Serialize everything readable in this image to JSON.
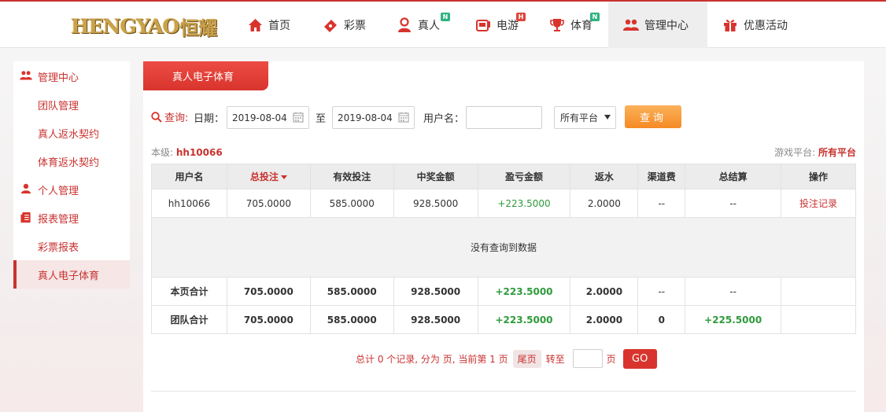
{
  "header": {
    "logo_text": "HENGYAO",
    "logo_cn": "恒耀",
    "nav": [
      {
        "label": "首页",
        "icon": "home-icon",
        "badge": ""
      },
      {
        "label": "彩票",
        "icon": "lottery-ticket-icon",
        "badge": ""
      },
      {
        "label": "真人",
        "icon": "live-dealer-icon",
        "badge": "N"
      },
      {
        "label": "电游",
        "icon": "slot-machine-icon",
        "badge": "H"
      },
      {
        "label": "体育",
        "icon": "trophy-icon",
        "badge": "N"
      },
      {
        "label": "管理中心",
        "icon": "management-users-icon",
        "badge": ""
      },
      {
        "label": "优惠活动",
        "icon": "gift-icon",
        "badge": ""
      }
    ],
    "active_nav": "管理中心"
  },
  "sidebar": {
    "items": [
      {
        "label": "管理中心",
        "type": "head"
      },
      {
        "label": "团队管理",
        "type": "sub"
      },
      {
        "label": "真人返水契约",
        "type": "sub"
      },
      {
        "label": "体育返水契约",
        "type": "sub"
      },
      {
        "label": "个人管理",
        "type": "head"
      },
      {
        "label": "报表管理",
        "type": "head"
      },
      {
        "label": "彩票报表",
        "type": "sub"
      },
      {
        "label": "真人电子体育",
        "type": "sub-active"
      }
    ]
  },
  "main": {
    "tab_title": "真人电子体育",
    "query": {
      "label": "查询:",
      "date_label": "日期：",
      "start_date": "2019-08-04",
      "to_label": "至",
      "end_date": "2019-08-04",
      "username_label": "用户名：",
      "username_value": "",
      "platform_selected": "所有平台",
      "search_button": "查询"
    },
    "level_label": "本级:",
    "level_user": "hh10066",
    "platform_label": "游戏平台:",
    "platform_value": "所有平台",
    "table": {
      "headers": [
        "用户名",
        "总投注",
        "有效投注",
        "中奖金额",
        "盈亏金额",
        "返水",
        "渠道费",
        "总结算",
        "操作"
      ],
      "rows": [
        [
          "hh10066",
          "705.0000",
          "585.0000",
          "928.5000",
          "+223.5000",
          "2.0000",
          "--",
          "--",
          "投注记录"
        ]
      ],
      "empty_message": "没有查询到数据",
      "page_total": [
        "本页合计",
        "705.0000",
        "585.0000",
        "928.5000",
        "+223.5000",
        "2.0000",
        "--",
        "--",
        ""
      ],
      "team_total": [
        "团队合计",
        "705.0000",
        "585.0000",
        "928.5000",
        "+223.5000",
        "2.0000",
        "0",
        "+225.5000",
        ""
      ]
    },
    "pagination": {
      "summary": "总计 0 个记录, 分为 页, 当前第 1 页",
      "last_page": "尾页",
      "goto_label": "转至",
      "page_unit": "页",
      "go_button": "GO",
      "page_input": ""
    }
  },
  "colors": {
    "accent": "#c8322f",
    "positive": "#2e9b3b",
    "search_button": "#f58a25"
  }
}
